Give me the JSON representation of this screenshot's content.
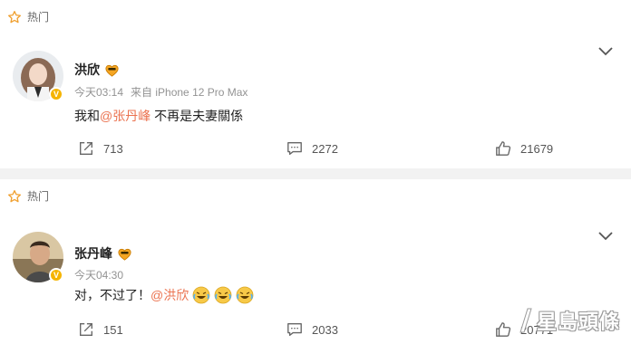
{
  "posts": [
    {
      "hot_label": "热门",
      "user_name": "洪欣",
      "time": "今天03:14",
      "source": "来自 iPhone 12 Pro Max",
      "content_prefix": "我和",
      "mention": "@张丹峰",
      "content_suffix": " 不再是夫妻關係",
      "reposts": "713",
      "comments": "2272",
      "likes": "21679"
    },
    {
      "hot_label": "热门",
      "user_name": "张丹峰",
      "time": "今天04:30",
      "source": "",
      "content_prefix": "对，不过了！",
      "mention": "@洪欣",
      "content_suffix": "",
      "reposts": "151",
      "comments": "2033",
      "likes": "20771"
    }
  ],
  "watermark": "星島頭條",
  "colors": {
    "mention": "#eb7350",
    "badge": "#f5b400",
    "hot_star": "#f0a030",
    "divider": "#f2f2f2"
  },
  "icons": [
    "hot-star-icon",
    "verified-badge-icon",
    "vip-heart-icon",
    "chevron-down-icon",
    "repost-icon",
    "comment-icon",
    "like-icon",
    "laugh-cry-emoji"
  ]
}
